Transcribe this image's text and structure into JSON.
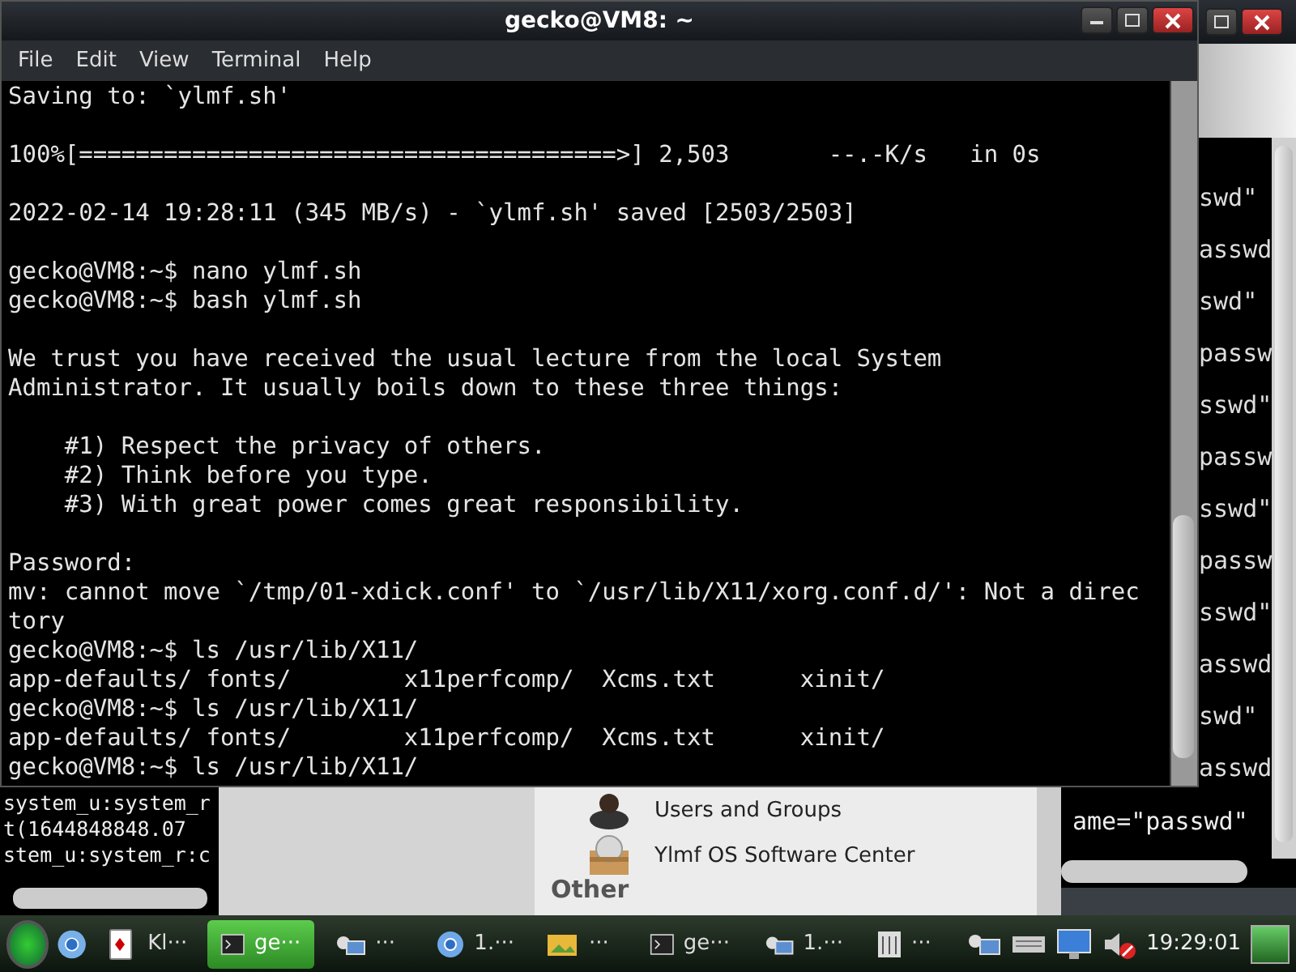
{
  "back_terminal_right": {
    "fragments": [
      "swd\"",
      "asswd",
      "swd\"",
      "passw",
      "sswd\"",
      "passw",
      "sswd\"",
      "passw",
      "sswd\"",
      "asswd",
      "swd\"",
      "asswd"
    ],
    "bottom_line": "ame=\"passwd\""
  },
  "back_terminal_left": {
    "lines": [
      "system_u:system_r",
      "t(1644848848.07",
      "stem_u:system_r:c"
    ]
  },
  "software_center": {
    "items": [
      {
        "label": "Users and Groups",
        "kind": "user"
      },
      {
        "label": "Ylmf OS Software Center",
        "kind": "package"
      }
    ],
    "section": "Other"
  },
  "window": {
    "title": "gecko@VM8: ~"
  },
  "menu": [
    "File",
    "Edit",
    "View",
    "Terminal",
    "Help"
  ],
  "terminal": {
    "blocks": [
      [
        "Saving to: `ylmf.sh'"
      ],
      [
        "100%[======================================>] 2,503       --.-K/s   in 0s"
      ],
      [
        "2022-02-14 19:28:11 (345 MB/s) - `ylmf.sh' saved [2503/2503]"
      ],
      [
        "gecko@VM8:~$ nano ylmf.sh",
        "gecko@VM8:~$ bash ylmf.sh"
      ],
      [
        "We trust you have received the usual lecture from the local System",
        "Administrator. It usually boils down to these three things:"
      ],
      [
        "    #1) Respect the privacy of others.",
        "    #2) Think before you type.",
        "    #3) With great power comes great responsibility."
      ],
      [
        "Password:",
        "mv: cannot move `/tmp/01-xdick.conf' to `/usr/lib/X11/xorg.conf.d/': Not a direc",
        "tory",
        "gecko@VM8:~$ ls /usr/lib/X11/",
        "app-defaults/ fonts/        x11perfcomp/  Xcms.txt      xinit/",
        "gecko@VM8:~$ ls /usr/lib/X11/",
        "app-defaults/ fonts/        x11perfcomp/  Xcms.txt      xinit/",
        "gecko@VM8:~$ ls /usr/lib/X11/"
      ]
    ]
  },
  "taskbar": {
    "tasks": [
      {
        "label": "Kl···",
        "kind": "cards",
        "selected": false
      },
      {
        "label": "ge···",
        "kind": "terminal",
        "selected": true
      },
      {
        "label": "···",
        "kind": "remote",
        "selected": false
      },
      {
        "label": "1.···",
        "kind": "browser",
        "selected": false
      },
      {
        "label": "···",
        "kind": "image",
        "selected": false
      },
      {
        "label": "ge···",
        "kind": "terminal",
        "selected": false
      },
      {
        "label": "1.···",
        "kind": "remote",
        "selected": false
      },
      {
        "label": "···",
        "kind": "calculator",
        "selected": false
      }
    ],
    "clock": "19:29:01"
  }
}
